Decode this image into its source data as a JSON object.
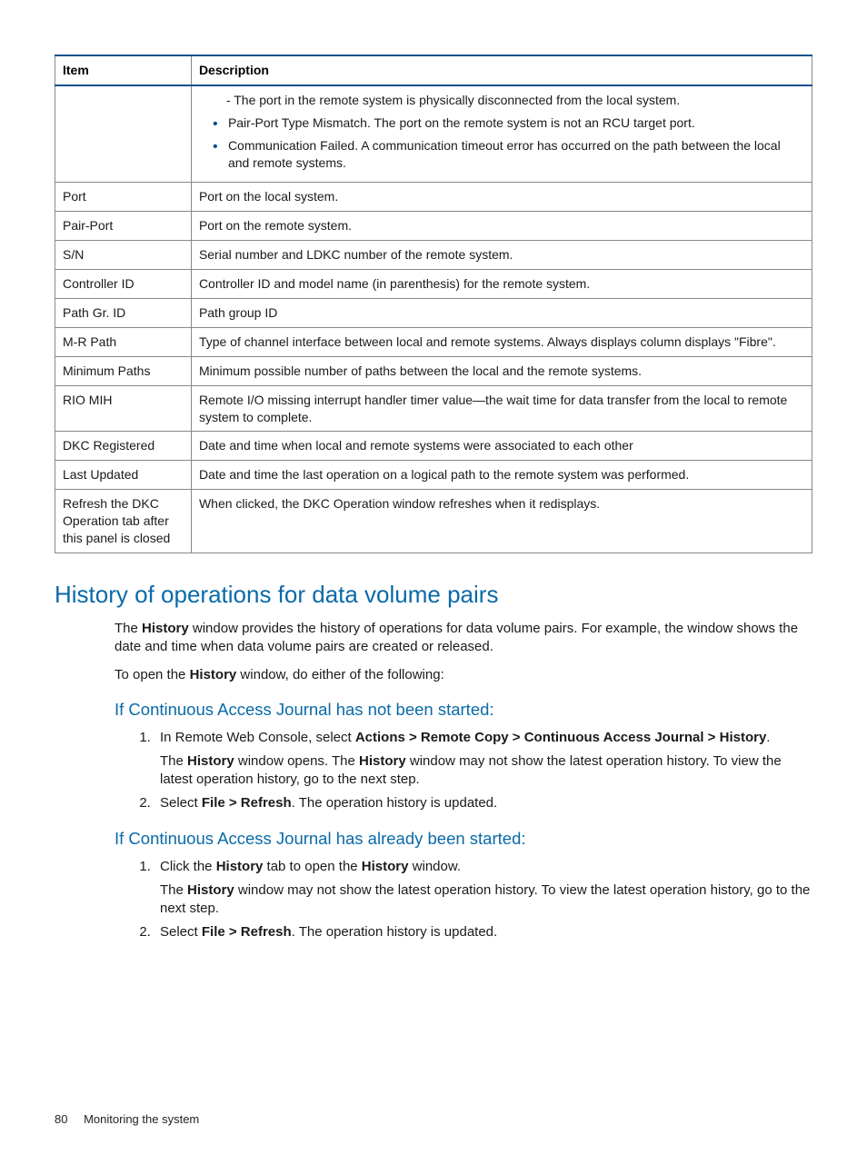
{
  "table": {
    "head": {
      "c1": "Item",
      "c2": "Description"
    },
    "row0": {
      "item": "",
      "sub": "- The port in the remote system is physically disconnected from the local system.",
      "b1": "Pair-Port Type Mismatch. The port on the remote system is not an RCU target port.",
      "b2": "Communication Failed. A communication timeout error has occurred on the path between the local and remote systems."
    },
    "rows": {
      "port": {
        "item": "Port",
        "desc": "Port on the local system."
      },
      "pair": {
        "item": "Pair-Port",
        "desc": "Port on the remote system."
      },
      "sn": {
        "item": "S/N",
        "desc": "Serial number and LDKC number of the remote system."
      },
      "cid": {
        "item": "Controller ID",
        "desc": "Controller ID and model name (in parenthesis) for the remote system."
      },
      "path": {
        "item": "Path Gr. ID",
        "desc": "Path group ID"
      },
      "mr": {
        "item": "M-R Path",
        "desc": "Type of channel interface between local and remote systems. Always displays column displays \"Fibre\"."
      },
      "min": {
        "item": "Minimum Paths",
        "desc": "Minimum possible number of paths between the local and the remote systems."
      },
      "rio": {
        "item": "RIO MIH",
        "desc": "Remote I/O missing interrupt handler timer value—the wait time for data transfer from the local to remote system to complete."
      },
      "dkc": {
        "item": "DKC Registered",
        "desc": "Date and time when local and remote systems were associated to each other"
      },
      "lu": {
        "item": "Last Updated",
        "desc": "Date and time the last operation on a logical path to the remote system was performed."
      },
      "ref": {
        "item": "Refresh the DKC Operation tab after this panel is closed",
        "desc": "When clicked, the DKC Operation window refreshes when it redisplays."
      }
    }
  },
  "section": {
    "heading": "History of operations for data volume pairs",
    "p1a": "The ",
    "p1bold": "History",
    "p1b": " window provides the history of operations for data volume pairs. For example, the window shows the date and time when data volume pairs are created or released.",
    "p2a": "To open the ",
    "p2bold": "History",
    "p2b": " window, do either of the following:",
    "sub1": "If Continuous Access Journal has not been started:",
    "l1s1a": "In Remote Web Console, select ",
    "l1s1b": "Actions > Remote Copy > Continuous Access Journal > History",
    "l1s1c": ".",
    "l1s1p_a": "The ",
    "l1s1p_b": "History",
    "l1s1p_c": " window opens. The ",
    "l1s1p_d": "History",
    "l1s1p_e": " window may not show the latest operation history. To view the latest operation history, go to the next step.",
    "l1s2a": "Select ",
    "l1s2b": "File > Refresh",
    "l1s2c": ". The operation history is updated.",
    "sub2": "If Continuous Access Journal has already been started:",
    "l2s1a": "Click the ",
    "l2s1b": "History",
    "l2s1c": " tab to open the ",
    "l2s1d": "History",
    "l2s1e": " window.",
    "l2s1p_a": "The ",
    "l2s1p_b": "History",
    "l2s1p_c": " window may not show the latest operation history. To view the latest operation history, go to the next step.",
    "l2s2a": "Select ",
    "l2s2b": "File > Refresh",
    "l2s2c": ". The operation history is updated."
  },
  "footer": {
    "page": "80",
    "title": "Monitoring the system"
  }
}
